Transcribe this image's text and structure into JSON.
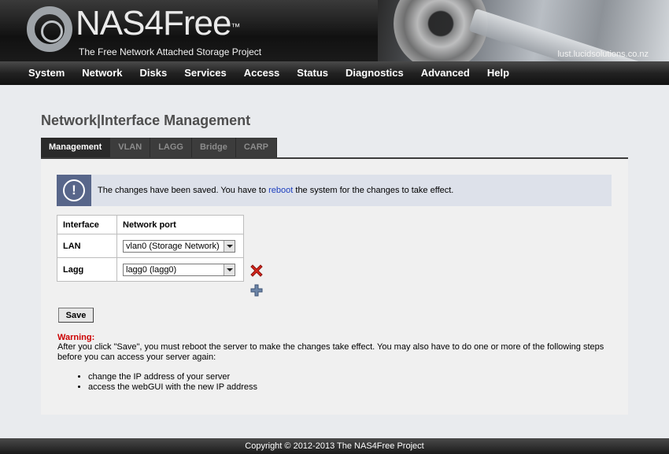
{
  "header": {
    "logo_text": "NAS4Free",
    "trademark": "™",
    "tagline": "The Free Network Attached Storage Project",
    "hostname": "lust.lucidsolutions.co.nz"
  },
  "nav": {
    "items": [
      "System",
      "Network",
      "Disks",
      "Services",
      "Access",
      "Status",
      "Diagnostics",
      "Advanced",
      "Help"
    ]
  },
  "page": {
    "title": "Network|Interface Management"
  },
  "tabs": [
    {
      "label": "Management",
      "active": true
    },
    {
      "label": "VLAN",
      "active": false
    },
    {
      "label": "LAGG",
      "active": false
    },
    {
      "label": "Bridge",
      "active": false
    },
    {
      "label": "CARP",
      "active": false
    }
  ],
  "notice": {
    "icon": "exclamation-icon",
    "text_before": "The changes have been saved. You have to ",
    "link": "reboot",
    "text_after": " the system for the changes to take effect."
  },
  "table": {
    "headers": [
      "Interface",
      "Network port"
    ],
    "rows": [
      {
        "interface": "LAN",
        "port": "vlan0 (Storage Network)"
      },
      {
        "interface": "Lagg",
        "port": "lagg0 (lagg0)"
      }
    ]
  },
  "actions": {
    "remove_icon": "red-x-icon",
    "add_icon": "plus-icon",
    "save_label": "Save"
  },
  "warning": {
    "title": "Warning:",
    "text": "After you click \"Save\", you must reboot the server to make the changes take effect. You may also have to do one or more of the following steps before you can access your server again:",
    "steps": [
      "change the IP address of your server",
      "access the webGUI with the new IP address"
    ]
  },
  "footer": {
    "copyright": "Copyright © 2012-2013 The NAS4Free Project"
  },
  "colors": {
    "notice_icon_bg": "#58668a",
    "notice_bg": "#dde1ea",
    "warning": "#cc0000",
    "link": "#1d3fbf"
  }
}
